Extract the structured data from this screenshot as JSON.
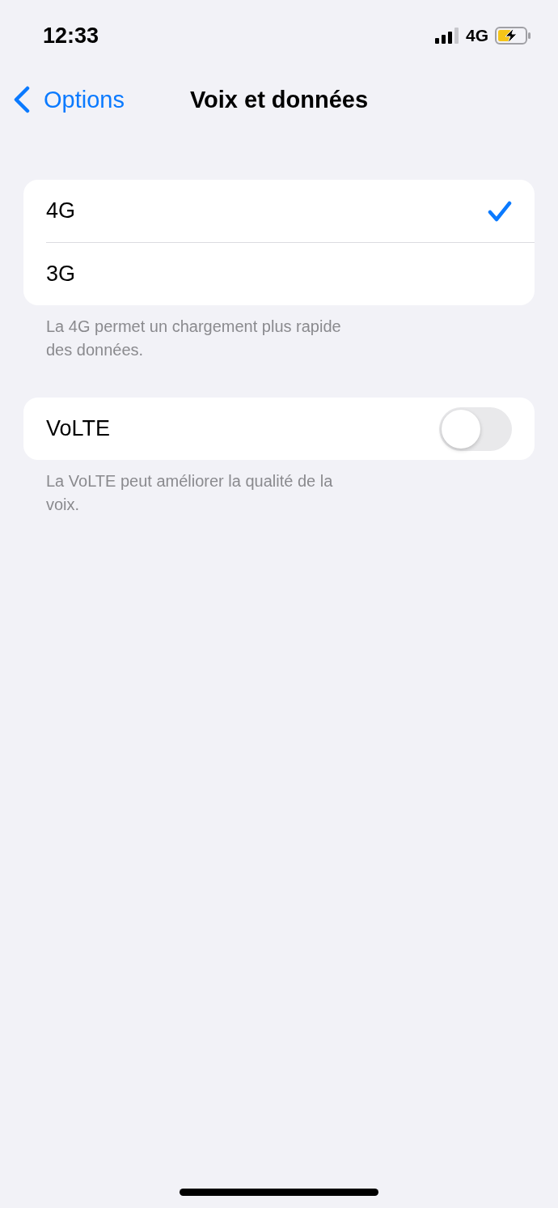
{
  "status_bar": {
    "time": "12:33",
    "network": "4G"
  },
  "nav": {
    "back": "Options",
    "title": "Voix et données"
  },
  "sections": [
    {
      "rows": [
        {
          "label": "4G",
          "kind": "choice",
          "selected": true
        },
        {
          "label": "3G",
          "kind": "choice",
          "selected": false
        }
      ],
      "footer": "La 4G permet un chargement plus rapide des données."
    },
    {
      "rows": [
        {
          "label": "VoLTE",
          "kind": "toggle",
          "on": false
        }
      ],
      "footer": "La VoLTE peut améliorer la qualité de la voix."
    }
  ]
}
